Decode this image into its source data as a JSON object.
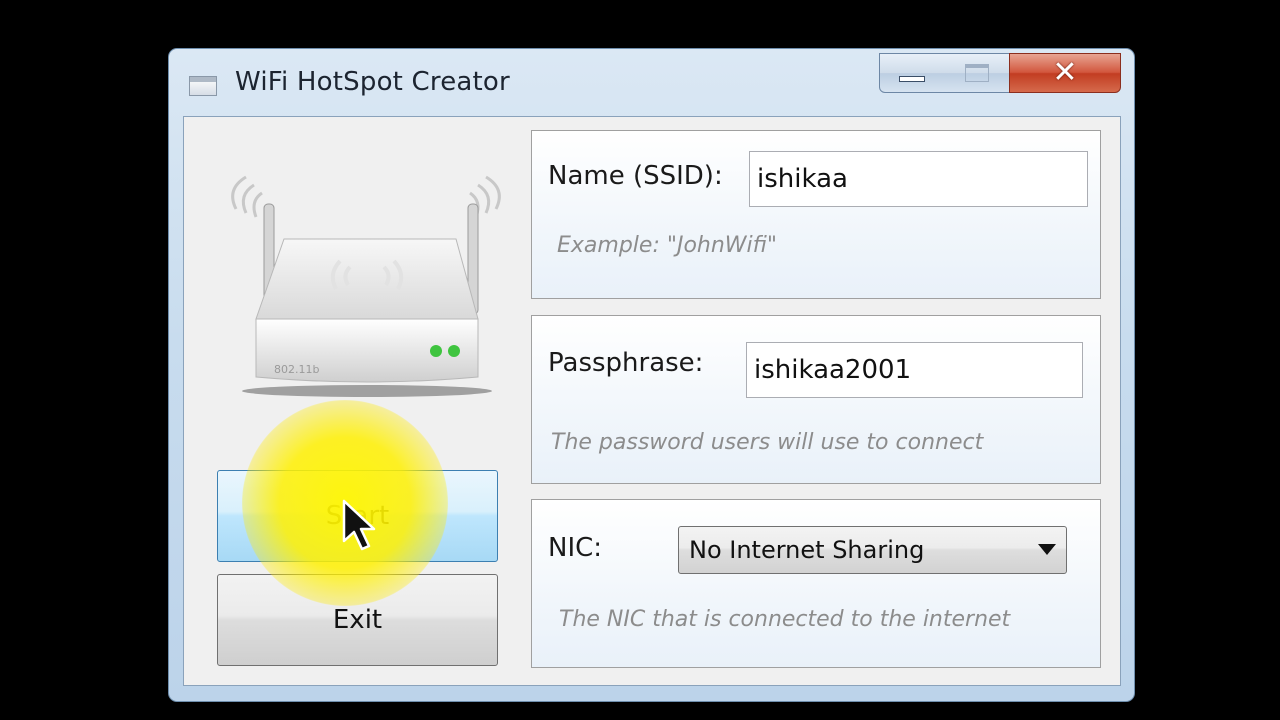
{
  "window": {
    "title": "WiFi HotSpot Creator",
    "icons": {
      "app": "window-app-icon",
      "minimize": "minimize-icon",
      "maximize": "maximize-icon",
      "close": "close-icon"
    }
  },
  "left_panel": {
    "image": "wireless-router-icon",
    "router_label": "802.11b",
    "start_label": "Start",
    "exit_label": "Exit"
  },
  "ssid_group": {
    "label": "Name (SSID):",
    "value": "ishikaa",
    "hint": "Example: \"JohnWifi\""
  },
  "passphrase_group": {
    "label": "Passphrase:",
    "value": "ishikaa2001",
    "hint": "The password users will use to connect"
  },
  "nic_group": {
    "label": "NIC:",
    "selected": "No Internet Sharing",
    "hint": "The NIC that is connected to the internet"
  },
  "colors": {
    "close_button": "#c94b30",
    "start_button": "#bee6fd",
    "cursor_highlight": "#fff200"
  }
}
